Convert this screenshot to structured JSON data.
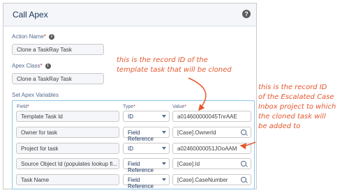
{
  "dialog": {
    "title": "Call Apex",
    "help_icon": "?"
  },
  "action_name": {
    "label": "Action Name",
    "required_mark": "*",
    "info_icon": "i",
    "value": "Clone a TaskRay Task"
  },
  "apex_class": {
    "label": "Apex Class",
    "required_mark": "*",
    "info_icon": "i",
    "value": "Clone a TaskRay Task"
  },
  "variables": {
    "section_label": "Set Apex Variables",
    "field_header": "Field",
    "type_header": "Type",
    "value_header": "Value",
    "required_mark": "*",
    "rows": [
      {
        "field": "Template Task Id",
        "type": "ID",
        "value": "a014600000045TnrAAE",
        "search": false
      },
      {
        "field": "Owner for task",
        "type": "Field Reference",
        "value": "[Case].OwnerId",
        "search": true
      },
      {
        "field": "Project for task",
        "type": "ID",
        "value": "a02460000051JOoAAM",
        "search": false
      },
      {
        "field": "Source Object Id (populates lookup fi...",
        "type": "Field Reference",
        "value": "[Case].Id",
        "search": true
      },
      {
        "field": "Task Name",
        "type": "Field Reference",
        "value": "[Case].CaseNumber",
        "search": true
      }
    ]
  },
  "annotations": {
    "note1": [
      "this is the record ID of the",
      "template task that will be cloned"
    ],
    "note2": [
      "this is the record ID",
      "of the Escalated Case",
      "Inbox project to which",
      "the cloned task will",
      "be added to"
    ],
    "color": "#e4572e"
  }
}
